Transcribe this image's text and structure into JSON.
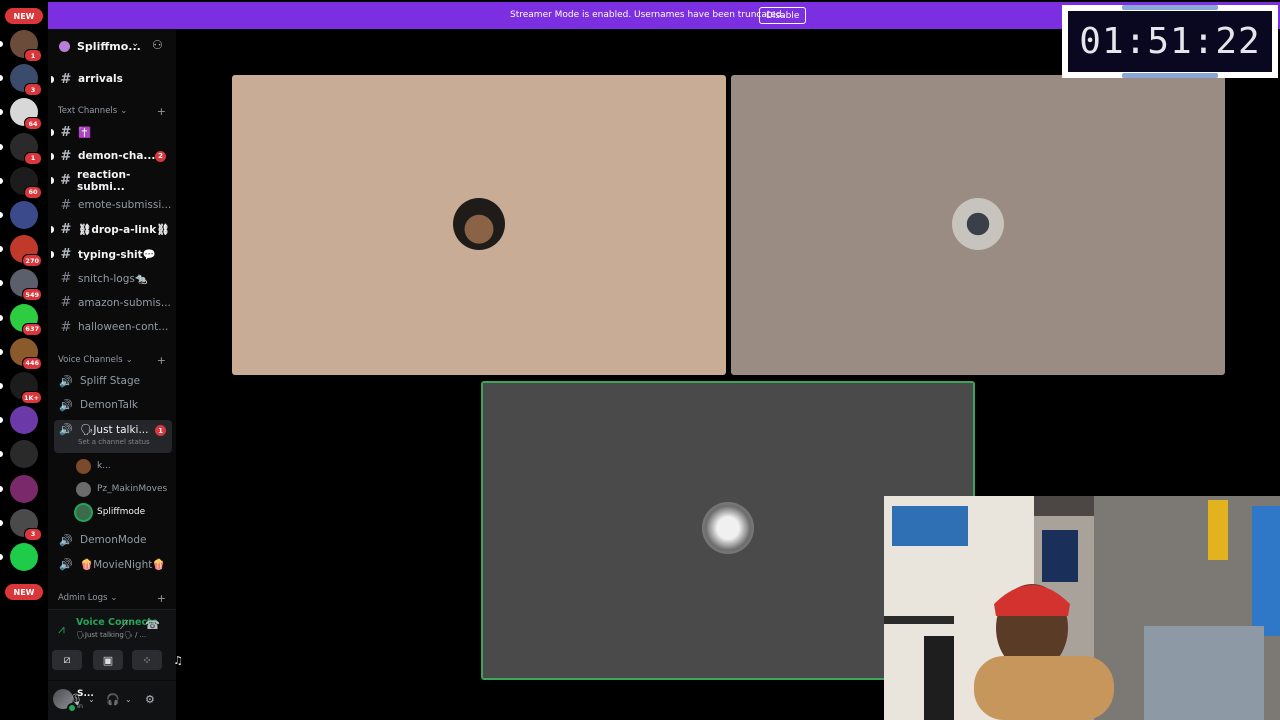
{
  "banner": {
    "text": "Streamer Mode is enabled. Usernames have been truncated.",
    "button": "Disable"
  },
  "rail": {
    "top_badge": "NEW",
    "bottom_badge": "NEW",
    "servers": [
      {
        "name": "server-1",
        "count": "1",
        "color": "#6b4b3a"
      },
      {
        "name": "server-2",
        "count": "3",
        "color": "#3a4b6b"
      },
      {
        "name": "server-3",
        "count": "64",
        "color": "#d8d8d8"
      },
      {
        "name": "server-4",
        "count": "1",
        "color": "#2a2a2a"
      },
      {
        "name": "server-5",
        "count": "60",
        "color": "#1c1c1c"
      },
      {
        "name": "server-6",
        "count": "",
        "color": "#3b4a8a"
      },
      {
        "name": "server-7",
        "count": "270",
        "color": "#c0392b"
      },
      {
        "name": "server-8",
        "count": "549",
        "color": "#5a5f6b"
      },
      {
        "name": "server-9",
        "count": "637",
        "color": "#2ecc40"
      },
      {
        "name": "server-10",
        "count": "446",
        "color": "#8a5a2a"
      },
      {
        "name": "server-11",
        "count": "1K+",
        "color": "#1c1c1c"
      },
      {
        "name": "server-12",
        "count": "",
        "color": "#6b3aa8"
      },
      {
        "name": "server-13",
        "count": "",
        "color": "#2a2a2a"
      },
      {
        "name": "server-14",
        "count": "",
        "color": "#7a2a6b"
      },
      {
        "name": "server-15",
        "count": "3",
        "color": "#4a4a4a"
      },
      {
        "name": "server-16",
        "count": "",
        "color": "#1fcc4a"
      }
    ]
  },
  "guild": {
    "name": "Spliffmo..."
  },
  "channels": {
    "top": [
      {
        "name": "arrivals",
        "unread": true,
        "mention": ""
      }
    ],
    "text_category": "Text Channels",
    "text": [
      {
        "name": "✝️",
        "unread": true,
        "mention": ""
      },
      {
        "name": "demon-cha...",
        "unread": true,
        "mention": "2"
      },
      {
        "name": "reaction-submi...",
        "unread": true,
        "mention": ""
      },
      {
        "name": "emote-submissi...",
        "unread": false,
        "mention": ""
      },
      {
        "name": "⛓drop-a-link⛓",
        "unread": true,
        "mention": ""
      },
      {
        "name": "typing-shit💬",
        "unread": true,
        "mention": ""
      },
      {
        "name": "snitch-logs🐀",
        "unread": false,
        "mention": ""
      },
      {
        "name": "amazon-submis...",
        "unread": false,
        "mention": ""
      },
      {
        "name": "halloween-cont...",
        "unread": false,
        "mention": ""
      }
    ],
    "voice_category": "Voice Channels",
    "voice": [
      {
        "name": "Spliff Stage"
      },
      {
        "name": "DemonTalk"
      }
    ],
    "active_voice": {
      "name": "🗣Just talki...",
      "status": "Set a channel status",
      "mention": "1",
      "members": [
        {
          "name": "k...",
          "self": false,
          "speaking": false
        },
        {
          "name": "Pz_MakinMoves",
          "self": false,
          "speaking": false
        },
        {
          "name": "Spliffmode",
          "self": true,
          "speaking": true
        }
      ]
    },
    "voice_after": [
      {
        "name": "DemonMode"
      },
      {
        "name": "🍿MovieNight🍿"
      }
    ],
    "admin_category": "Admin Logs"
  },
  "voice_panel": {
    "title": "Voice Connecte",
    "subtitle": "🗣Just talking🗣 / ..."
  },
  "user": {
    "name": "S...",
    "status": "In"
  },
  "timer": {
    "value": "01:51:22"
  },
  "colors": {
    "accent_purple": "#7b2fe0",
    "speaking_green": "#3ba55c",
    "mention_red": "#da373c"
  }
}
